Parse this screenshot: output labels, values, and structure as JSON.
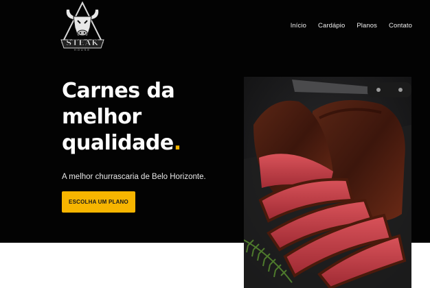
{
  "brand": {
    "name": "STEAK",
    "tagline": "HOUSE",
    "logo_icon": "bull-head-icon"
  },
  "nav": {
    "items": [
      {
        "label": "Início"
      },
      {
        "label": "Cardápio"
      },
      {
        "label": "Planos"
      },
      {
        "label": "Contato"
      }
    ]
  },
  "hero": {
    "headline_line1": "Carnes da",
    "headline_line2": "melhor",
    "headline_line3": "qualidade",
    "headline_dot": ".",
    "subtitle": "A melhor churrascaria de Belo Horizonte.",
    "cta_label": "ESCOLHA UM PLANO",
    "image_subject": "sliced grilled steak with rosemary and knife"
  },
  "colors": {
    "background": "#030303",
    "accent": "#f7b500",
    "text": "#ffffff"
  }
}
